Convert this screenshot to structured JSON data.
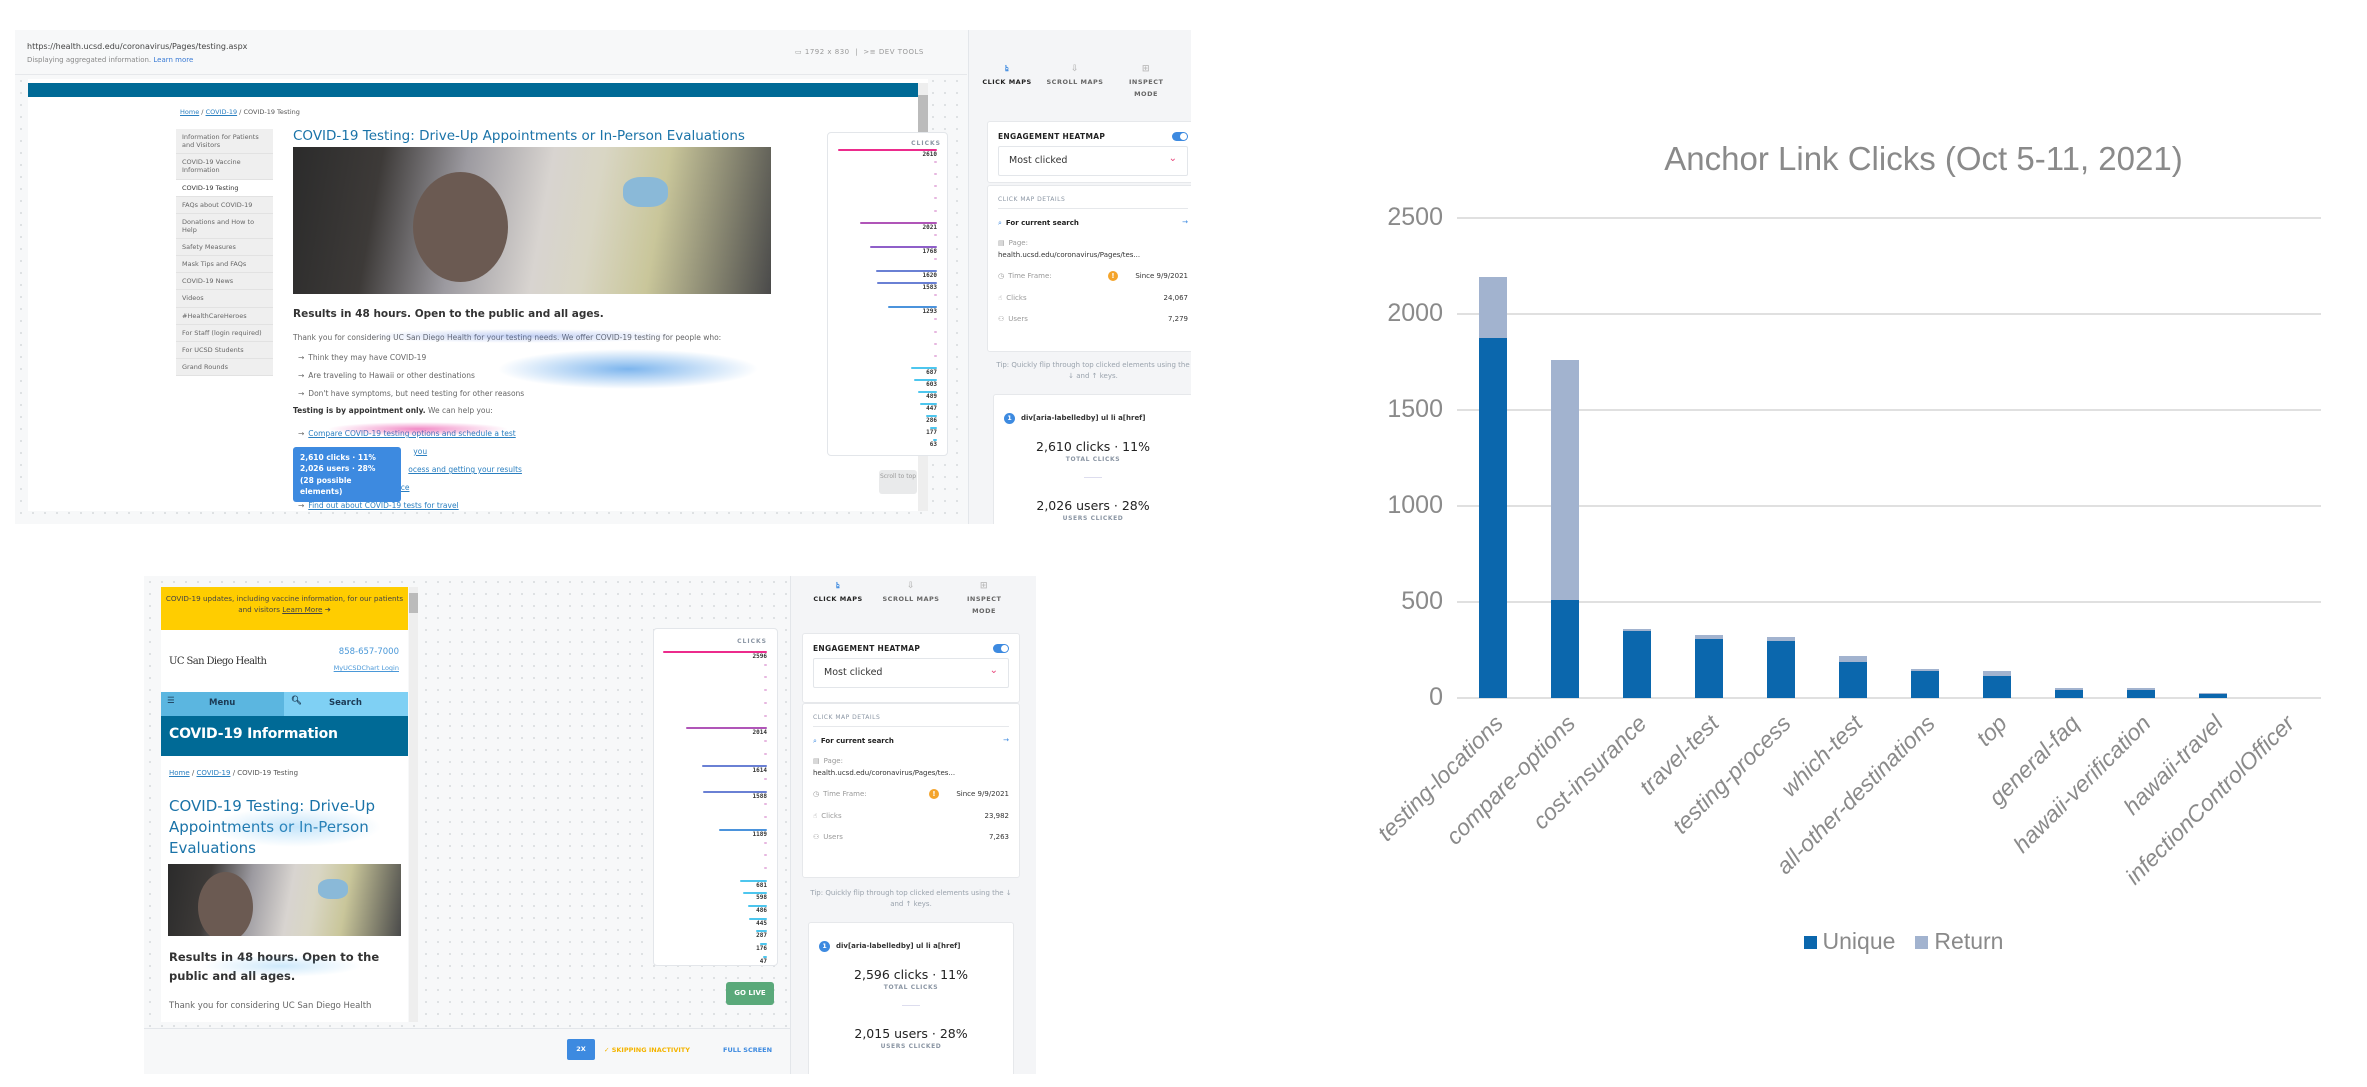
{
  "screen_top": {
    "url": "https://health.ucsd.edu/coronavirus/Pages/testing.aspx",
    "subtext": "Displaying aggregated information.",
    "learn_more": "Learn more",
    "resolution": "1792 x 830",
    "dev_tools": "DEV TOOLS",
    "breadcrumb": {
      "home": "Home",
      "covid": "COVID-19",
      "current": "COVID-19 Testing",
      "sep": "/"
    },
    "nav_items": [
      "Information for Patients and Visitors",
      "COVID-19 Vaccine Information",
      "COVID-19 Testing",
      "FAQs about COVID-19",
      "Donations and How to Help",
      "Safety Measures",
      "Mask Tips and FAQs",
      "COVID-19 News",
      "Videos",
      "#HealthCareHeroes",
      "For Staff (login required)",
      "For UCSD Students",
      "Grand Rounds"
    ],
    "nav_active": "COVID-19 Testing",
    "title": "COVID-19 Testing: Drive-Up Appointments or In-Person Evaluations",
    "results": "Results in 48 hours. Open to the public and all ages.",
    "intro": "Thank you for considering UC San Diego Health for your testing needs. We offer COVID-19 testing for people who:",
    "bullets": [
      "Think they may have COVID-19",
      "Are traveling to Hawaii or other destinations",
      "Don't have symptoms, but need testing for other reasons"
    ],
    "appt_bold": "Testing is by appointment only.",
    "appt_rest": "We can help you:",
    "links": [
      "Compare COVID-19 testing options and schedule a test",
      "you",
      "ocess and getting your results",
      "rance",
      "Find out about COVID-19 tests for travel"
    ],
    "tooltip": {
      "line1": "2,610 clicks · 11%",
      "line2": "2,026 users · 28%",
      "line3": "(28 possible elements)"
    },
    "scroll_top": "Scroll to top",
    "clicks_header": "CLICKS",
    "click_rows": [
      2610,
      null,
      null,
      null,
      null,
      null,
      2021,
      null,
      1768,
      null,
      1620,
      1583,
      null,
      1293,
      null,
      null,
      null,
      null,
      687,
      603,
      489,
      447,
      286,
      177,
      63
    ],
    "panel": {
      "tabs": [
        "CLICK MAPS",
        "SCROLL MAPS",
        "INSPECT MODE"
      ],
      "heatmap_label": "ENGAGEMENT HEATMAP",
      "heatmap_on": true,
      "dropdown": "Most clicked",
      "details_header": "CLICK MAP DETAILS",
      "current_search": "For current search",
      "page_label": "Page:",
      "page_value": "health.ucsd.edu/coronavirus/Pages/tes...",
      "timeframe_label": "Time Frame:",
      "timeframe_value": "Since 9/9/2021",
      "clicks_label": "Clicks",
      "clicks_value": "24,067",
      "users_label": "Users",
      "users_value": "7,279",
      "tip": "Tip: Quickly flip through top clicked elements using the ↓ and ↑ keys.",
      "rank": "1",
      "selector": "div[aria-labelledby] ul li a[href]",
      "total_clicks": "2,610 clicks · 11%",
      "total_clicks_cap": "TOTAL CLICKS",
      "users_clicked": "2,026 users · 28%",
      "users_clicked_cap": "USERS CLICKED"
    }
  },
  "screen_bottom": {
    "banner": "COVID-19 updates, including vaccine information, for our patients and visitors",
    "banner_link": "Learn More",
    "logo": "UC San Diego Health",
    "phone": "858-657-7000",
    "mychart": "MyUCSDChart Login",
    "menu": "Menu",
    "search": "Search",
    "section": "COVID-19 Information",
    "breadcrumb": {
      "home": "Home",
      "covid": "COVID-19",
      "current": "COVID-19 Testing",
      "sep": "/"
    },
    "title": "COVID-19 Testing: Drive-Up Appointments or In-Person Evaluations",
    "results": "Results in 48 hours. Open to the public and all ages.",
    "intro": "Thank you for considering UC San Diego Health",
    "clicks_header": "CLICKS",
    "click_rows": [
      2596,
      null,
      null,
      null,
      null,
      null,
      2014,
      null,
      null,
      1614,
      null,
      1588,
      null,
      null,
      1189,
      null,
      null,
      null,
      681,
      598,
      486,
      445,
      287,
      176,
      47
    ],
    "go_live": "GO LIVE",
    "speed": "2X",
    "skipping": "✓ SKIPPING INACTIVITY",
    "full_screen": "FULL SCREEN",
    "panel": {
      "tabs": [
        "CLICK MAPS",
        "SCROLL MAPS",
        "INSPECT MODE"
      ],
      "heatmap_label": "ENGAGEMENT HEATMAP",
      "heatmap_on": true,
      "dropdown": "Most clicked",
      "details_header": "CLICK MAP DETAILS",
      "current_search": "For current search",
      "page_label": "Page:",
      "page_value": "health.ucsd.edu/coronavirus/Pages/tes...",
      "timeframe_label": "Time Frame:",
      "timeframe_value": "Since 9/9/2021",
      "clicks_label": "Clicks",
      "clicks_value": "23,982",
      "users_label": "Users",
      "users_value": "7,263",
      "tip": "Tip: Quickly flip through top clicked elements using the ↓ and ↑ keys.",
      "rank": "1",
      "selector": "div[aria-labelledby] ul li a[href]",
      "total_clicks": "2,596 clicks · 11%",
      "total_clicks_cap": "TOTAL CLICKS",
      "users_clicked": "2,015 users · 28%",
      "users_clicked_cap": "USERS CLICKED"
    }
  },
  "chart_data": {
    "type": "bar",
    "stacked": true,
    "title": "Anchor Link Clicks (Oct 5-11, 2021)",
    "categories": [
      "testing-locations",
      "compare-options",
      "cost-insurance",
      "travel-test",
      "testing-process",
      "which-test",
      "all-other-destinations",
      "top",
      "general-faq",
      "hawaii-verification",
      "hawaii-travel",
      "infectionControlOfficer"
    ],
    "series": [
      {
        "name": "Unique",
        "color": "#0b67ad",
        "values": [
          1873,
          511,
          348,
          306,
          296,
          185,
          139,
          117,
          44,
          44,
          22,
          0
        ]
      },
      {
        "name": "Return",
        "color": "#a2b3cf",
        "values": [
          320,
          1251,
          10,
          22,
          20,
          32,
          10,
          22,
          6,
          6,
          6,
          0
        ]
      }
    ],
    "ylim": [
      0,
      2500
    ],
    "yticks": [
      "0",
      "500",
      "1000",
      "1500",
      "2000",
      "2500"
    ],
    "grid": true,
    "legend": "bottom",
    "xlabel": "",
    "ylabel": ""
  }
}
